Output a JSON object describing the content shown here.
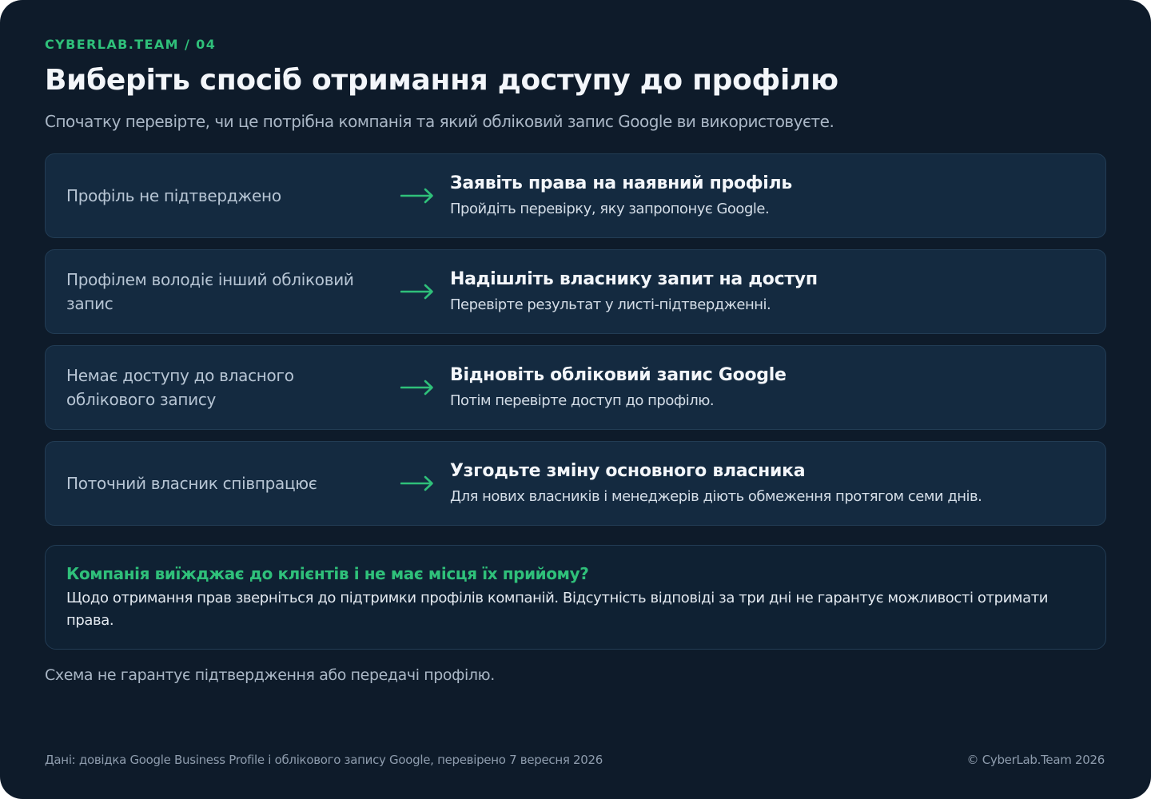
{
  "header": {
    "eyebrow": "CYBERLAB.TEAM / 04",
    "title": "Виберіть спосіб отримання доступу до профілю",
    "subtitle": "Спочатку перевірте, чи це потрібна компанія та який обліковий запис Google ви використовуєте."
  },
  "rows": [
    {
      "situation": "Профіль не підтверджено",
      "action": "Заявіть права на наявний профіль",
      "detail": "Пройдіть перевірку, яку запропонує Google."
    },
    {
      "situation": "Профілем володіє інший обліковий запис",
      "action": "Надішліть власнику запит на доступ",
      "detail": "Перевірте результат у листі-підтвердженні."
    },
    {
      "situation": "Немає доступу до власного облікового запису",
      "action": "Відновіть обліковий запис Google",
      "detail": "Потім перевірте доступ до профілю."
    },
    {
      "situation": "Поточний власник співпрацює",
      "action": "Узгодьте зміну основного власника",
      "detail": "Для нових власників і менеджерів діють обмеження протягом семи днів."
    }
  ],
  "note": {
    "title": "Компанія виїжджає до клієнтів і не має місця їх прийому?",
    "text": "Щодо отримання прав зверніться до підтримки профілів компаній. Відсутність відповіді за три дні не гарантує можливості отримати права."
  },
  "disclaimer": "Схема не гарантує підтвердження або передачі профілю.",
  "footer": {
    "source": "Дані: довідка Google Business Profile і облікового запису Google, перевірено 7 вересня 2026",
    "copyright": "© CyberLab.Team  2026"
  },
  "colors": {
    "background": "#0e1b2a",
    "card": "#142a40",
    "accent": "#2fc07a"
  },
  "icons": {
    "row_arrow": "arrow-right-icon"
  }
}
